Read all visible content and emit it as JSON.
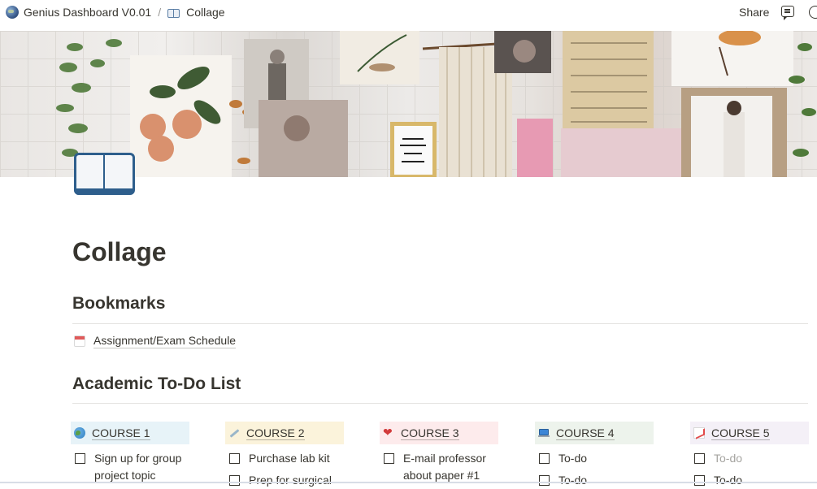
{
  "topbar": {
    "workspace": "Genius Dashboard V0.01",
    "separator": "/",
    "page": "Collage",
    "share_label": "Share"
  },
  "icons": {
    "workspace": "globe-icon",
    "page_crumb": "open-book-icon",
    "comments": "comment-icon",
    "updates": "clock-icon",
    "page": "open-book-icon",
    "bookmark": "calendar-icon"
  },
  "page": {
    "title": "Collage"
  },
  "bookmarks": {
    "heading": "Bookmarks",
    "items": [
      {
        "label": "Assignment/Exam Schedule"
      }
    ]
  },
  "todo": {
    "heading": "Academic To-Do List",
    "columns": [
      {
        "label": "COURSE 1",
        "icon": "earth-globe-icon",
        "color": "#e7f3f8",
        "items": [
          {
            "text": "Sign up for group project topic",
            "muted": false
          }
        ]
      },
      {
        "label": "COURSE 2",
        "icon": "syringe-icon",
        "color": "#fbf3db",
        "items": [
          {
            "text": "Purchase lab kit",
            "muted": false
          },
          {
            "text": "Prep for surgical",
            "muted": false
          }
        ]
      },
      {
        "label": "COURSE 3",
        "icon": "heart-icon",
        "color": "#fdebec",
        "items": [
          {
            "text": "E-mail professor about paper #1",
            "muted": false
          }
        ]
      },
      {
        "label": "COURSE 4",
        "icon": "laptop-icon",
        "color": "#edf3ec",
        "items": [
          {
            "text": "To-do",
            "muted": false
          },
          {
            "text": "To-do",
            "muted": false
          }
        ]
      },
      {
        "label": "COURSE 5",
        "icon": "chart-increasing-icon",
        "color": "#f4f0f7",
        "items": [
          {
            "text": "To-do",
            "muted": true
          },
          {
            "text": "To-do",
            "muted": false
          }
        ]
      }
    ]
  }
}
